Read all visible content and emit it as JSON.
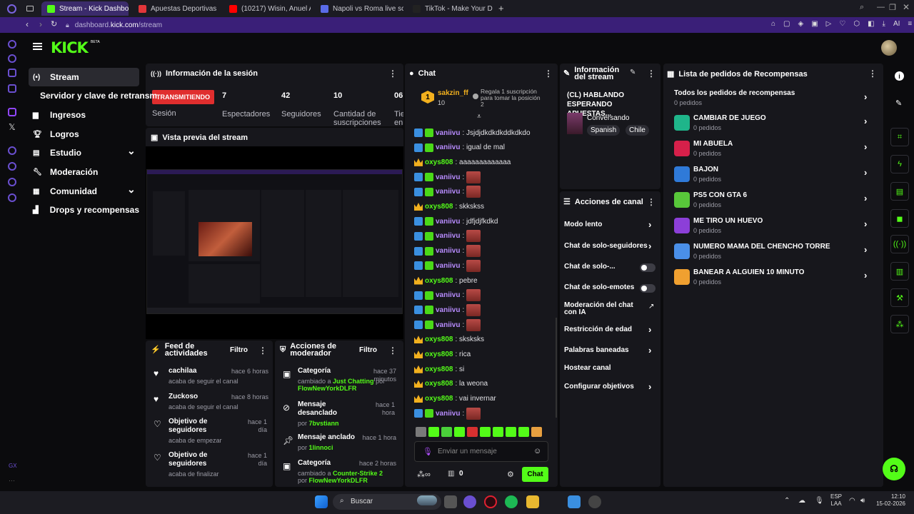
{
  "browser": {
    "tabs": [
      {
        "title": "Stream - Kick Dashboard",
        "color": "#53fc18"
      },
      {
        "title": "Apuestas Deportivas - Ap",
        "color": "#e2363a"
      },
      {
        "title": "(10217) Wisin, Anuel A",
        "color": "#ff0000"
      },
      {
        "title": "Napoli vs Roma live score",
        "color": "#5a6be8"
      },
      {
        "title": "TikTok - Make Your Day",
        "color": "#222"
      }
    ],
    "url_pre": "dashboard.",
    "url_host": "kick.com",
    "url_path": "/stream"
  },
  "sidebar": {
    "items": [
      {
        "label": "Stream",
        "icon": "broadcast-icon"
      },
      {
        "label": "Servidor y clave de retransm"
      },
      {
        "label": "Ingresos",
        "icon": "chart-icon"
      },
      {
        "label": "Logros",
        "icon": "trophy-icon"
      },
      {
        "label": "Estudio",
        "icon": "studio-icon"
      },
      {
        "label": "Moderación",
        "icon": "wrench-icon"
      },
      {
        "label": "Comunidad",
        "icon": "community-icon"
      },
      {
        "label": "Drops y recompensas",
        "icon": "drops-icon"
      }
    ]
  },
  "session": {
    "title": "Información de la sesión",
    "live": "TRANSMITIENDO",
    "session_label": "Sesión",
    "stats": [
      {
        "v": "7",
        "l": "Espectadores"
      },
      {
        "v": "42",
        "l": "Seguidores"
      },
      {
        "v": "10",
        "l": "Cantidad de suscripciones"
      },
      {
        "v": "06",
        "l": "Tie en"
      }
    ]
  },
  "preview": {
    "title": "Vista previa del stream"
  },
  "feed": {
    "title": "Feed de actividades",
    "filter": "Filtro",
    "items": [
      {
        "name": "cachilaa",
        "time": "hace 6 horas",
        "sub": "acaba de seguir el canal"
      },
      {
        "name": "Zuckoso",
        "time": "hace 8 horas",
        "sub": "acaba de seguir el canal"
      },
      {
        "name": "Objetivo de seguidores",
        "time": "hace 1 día",
        "sub": "acaba de empezar"
      },
      {
        "name": "Objetivo de seguidores",
        "time": "hace 1 día",
        "sub": "acaba de finalizar"
      }
    ]
  },
  "modactions": {
    "title": "Acciones de moderador",
    "filter": "Filtro",
    "items": [
      {
        "name": "Categoría",
        "time": "hace 37 minutos",
        "sub": "cambiado a",
        "hl": "Just Chatting",
        "by": "por",
        "user": "FlowNewYorkDLFR"
      },
      {
        "name": "Mensaje desanclado",
        "time": "hace 1 hora",
        "sub": "por",
        "hl": "7bvstiann",
        "by": "",
        "user": ""
      },
      {
        "name": "Mensaje anclado",
        "time": "hace 1 hora",
        "sub": "por",
        "hl": "1linnoci",
        "by": "",
        "user": ""
      },
      {
        "name": "Categoría",
        "time": "hace 2 horas",
        "sub": "cambiado a",
        "hl": "Counter-Strike 2",
        "by": "por",
        "user": "FlowNewYorkDLFR"
      }
    ]
  },
  "chat": {
    "title": "Chat",
    "gift_user": "sakzin_ff",
    "gift_count": "10",
    "gift_text": "Regala 1 suscripción para tomar la posición 2",
    "messages": [
      {
        "u": "vaniivu",
        "t": ": Jsjdjdkdkdkddkdkdo",
        "badge": "blue",
        "emote": false
      },
      {
        "u": "vaniivu",
        "t": ": igual de mal",
        "badge": "blue",
        "emote": false
      },
      {
        "u": "oxys808",
        "t": ": aaaaaaaaaaaaa",
        "badge": "crown",
        "emote": false
      },
      {
        "u": "vaniivu",
        "t": ":",
        "badge": "blue",
        "emote": true
      },
      {
        "u": "vaniivu",
        "t": ":",
        "badge": "blue",
        "emote": true
      },
      {
        "u": "oxys808",
        "t": ": skkskss",
        "badge": "crown",
        "emote": false
      },
      {
        "u": "vaniivu",
        "t": ": jdfjdjfkdkd",
        "badge": "blue",
        "emote": false
      },
      {
        "u": "vaniivu",
        "t": ":",
        "badge": "blue",
        "emote": true
      },
      {
        "u": "vaniivu",
        "t": ":",
        "badge": "blue",
        "emote": true
      },
      {
        "u": "vaniivu",
        "t": ":",
        "badge": "blue",
        "emote": true
      },
      {
        "u": "oxys808",
        "t": ": pebre",
        "badge": "crown",
        "emote": false
      },
      {
        "u": "vaniivu",
        "t": ":",
        "badge": "blue",
        "emote": true
      },
      {
        "u": "vaniivu",
        "t": ":",
        "badge": "blue",
        "emote": true
      },
      {
        "u": "vaniivu",
        "t": ":",
        "badge": "blue",
        "emote": true
      },
      {
        "u": "oxys808",
        "t": ": sksksks",
        "badge": "crown",
        "emote": false
      },
      {
        "u": "oxys808",
        "t": ": rica",
        "badge": "crown",
        "emote": false
      },
      {
        "u": "oxys808",
        "t": ": si",
        "badge": "crown",
        "emote": false
      },
      {
        "u": "oxys808",
        "t": ": la weona",
        "badge": "crown",
        "emote": false
      },
      {
        "u": "oxys808",
        "t": ": vai invernar",
        "badge": "crown",
        "emote": false
      },
      {
        "u": "vaniivu",
        "t": ":",
        "badge": "blue",
        "emote": true
      }
    ],
    "input_placeholder": "Enviar un mensaje",
    "points": "0",
    "send": "Chat"
  },
  "streaminfo": {
    "title": "Información del stream",
    "stream_title": "(CL) HABLANDO ESPERANDO APUESTAS...",
    "category": "Conversando",
    "tags": [
      "Spanish",
      "Chile"
    ]
  },
  "channel_actions": {
    "title": "Acciones de canal",
    "items": [
      {
        "label": "Modo lento",
        "ctrl": "chevron"
      },
      {
        "label": "Chat de solo-seguidores",
        "ctrl": "chevron"
      },
      {
        "label": "Chat de solo-...",
        "ctrl": "toggle"
      },
      {
        "label": "Chat de solo-emotes",
        "ctrl": "toggle"
      },
      {
        "label": "Moderación del chat con IA",
        "ctrl": "link"
      },
      {
        "label": "Restricción de edad",
        "ctrl": "chevron"
      },
      {
        "label": "Palabras baneadas",
        "ctrl": "chevron"
      },
      {
        "label": "Hostear canal",
        "ctrl": "none"
      },
      {
        "label": "Configurar objetivos",
        "ctrl": "chevron"
      }
    ]
  },
  "rewards": {
    "title": "Lista de pedidos de Recompensas",
    "all": "Todos los pedidos de recompensas",
    "all_count": "0 pedidos",
    "items": [
      {
        "name": "CAMBIAR DE JUEGO",
        "count": "0 pedidos",
        "color": "#1fb58a"
      },
      {
        "name": "MI ABUELA",
        "count": "0 pedidos",
        "color": "#d6204a"
      },
      {
        "name": "BAJON",
        "count": "0 pedidos",
        "color": "#2f7ad8"
      },
      {
        "name": "PS5 CON GTA 6",
        "count": "0 pedidos",
        "color": "#58c73a"
      },
      {
        "name": "ME TIRO UN HUEVO",
        "count": "0 pedidos",
        "color": "#8c3fd8"
      },
      {
        "name": "NUMERO MAMA DEL CHENCHO TORRE",
        "count": "0 pedidos",
        "color": "#4a8fe8"
      },
      {
        "name": "BANEAR A ALGUIEN 10 MINUTO",
        "count": "0 pedidos",
        "color": "#f0a030"
      }
    ]
  },
  "taskbar": {
    "search": "Buscar",
    "lang1": "ESP",
    "lang2": "LAA",
    "time": "12:10",
    "date": "15-02-2026"
  },
  "colors": {
    "kick_green": "#53fc18",
    "panel": "#17171c",
    "browser_accent": "#3a1f78"
  }
}
